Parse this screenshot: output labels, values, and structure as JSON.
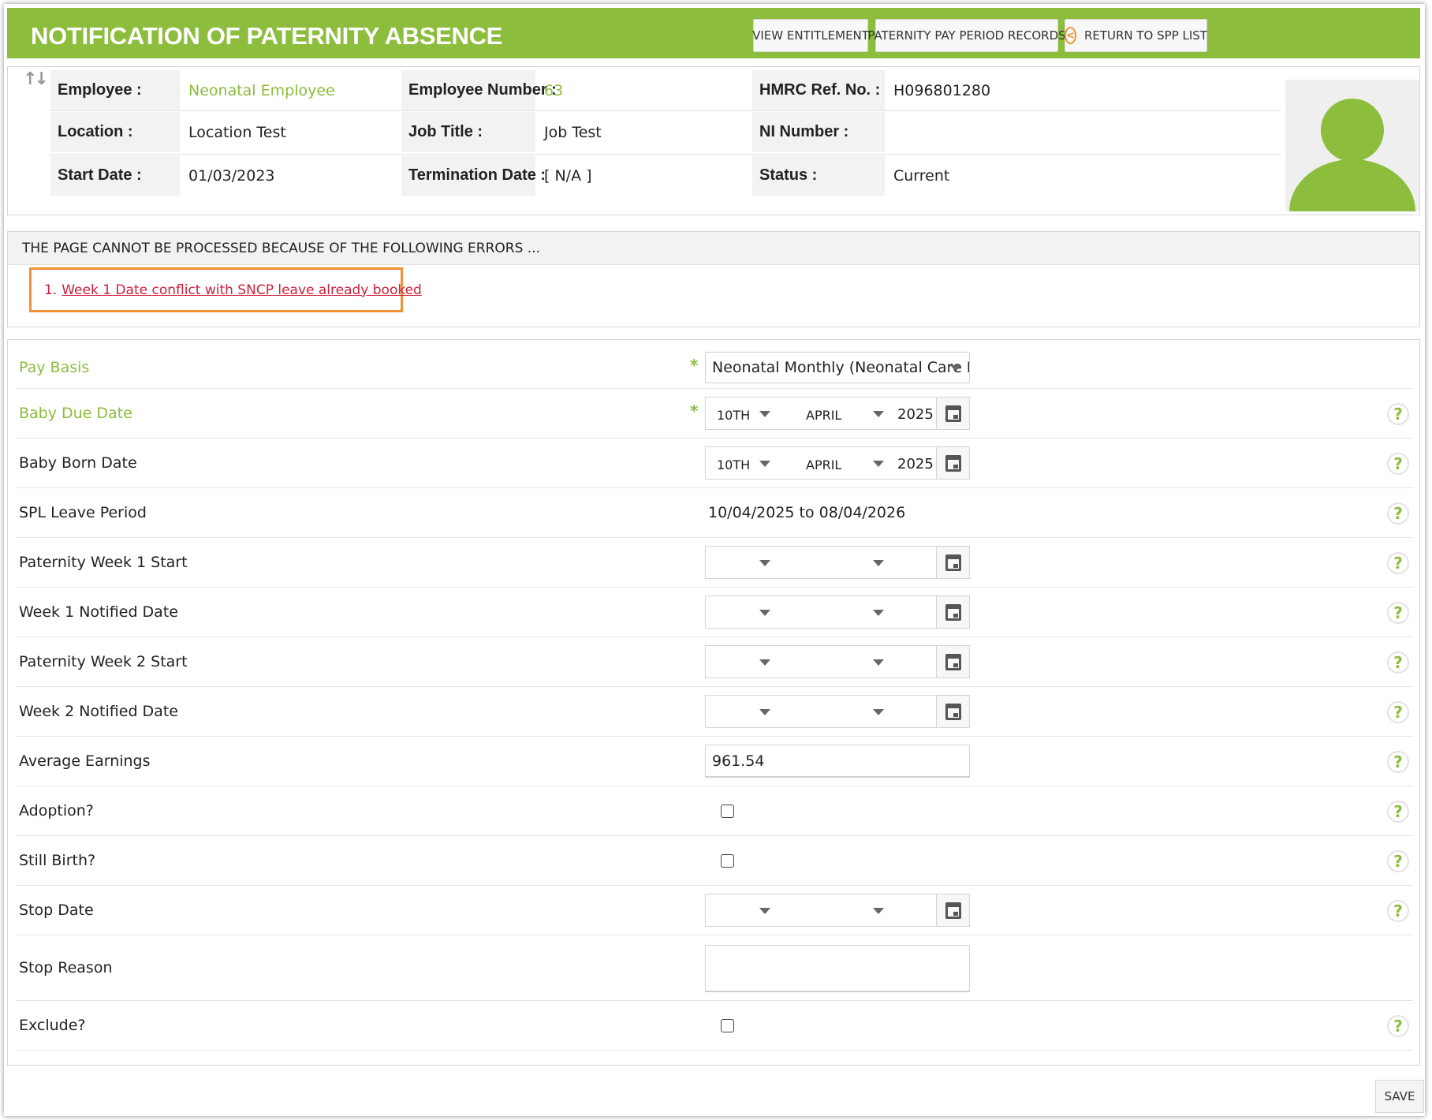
{
  "header": {
    "title": "NOTIFICATION OF PATERNITY ABSENCE",
    "buttons": {
      "view_entitlement": "VIEW ENTITLEMENT",
      "pay_period_records": "PATERNITY PAY PERIOD RECORDS",
      "return_to_list": "RETURN TO SPP LIST"
    }
  },
  "employee": {
    "employee_label": "Employee :",
    "employee_value": "Neonatal Employee",
    "employee_number_label": "Employee Number :",
    "employee_number_value": "63",
    "hmrc_label": "HMRC Ref. No. :",
    "hmrc_value": "H096801280",
    "location_label": "Location :",
    "location_value": "Location Test",
    "job_title_label": "Job Title :",
    "job_title_value": "Job Test",
    "ni_label": "NI Number :",
    "ni_value": "",
    "start_date_label": "Start Date :",
    "start_date_value": "01/03/2023",
    "termination_label": "Termination Date :",
    "termination_value": "[ N/A ]",
    "status_label": "Status :",
    "status_value": "Current"
  },
  "errors": {
    "heading": "THE PAGE CANNOT BE PROCESSED BECAUSE OF THE FOLLOWING ERRORS ...",
    "items": [
      {
        "number": "1.",
        "text": "Week 1 Date conflict with SNCP leave already booked"
      }
    ]
  },
  "form": {
    "pay_basis": {
      "label": "Pay Basis",
      "value": "Neonatal Monthly (Neonatal Care L"
    },
    "baby_due_date": {
      "label": "Baby Due Date",
      "day": "10TH",
      "month": "APRIL",
      "year": "2025"
    },
    "baby_born_date": {
      "label": "Baby Born Date",
      "day": "10TH",
      "month": "APRIL",
      "year": "2025"
    },
    "spl_leave_period": {
      "label": "SPL Leave Period",
      "value": "10/04/2025 to 08/04/2026"
    },
    "paternity_week1_start": {
      "label": "Paternity Week 1 Start"
    },
    "week1_notified_date": {
      "label": "Week 1 Notified Date"
    },
    "paternity_week2_start": {
      "label": "Paternity Week 2 Start"
    },
    "week2_notified_date": {
      "label": "Week 2 Notified Date"
    },
    "average_earnings": {
      "label": "Average Earnings",
      "value": "961.54"
    },
    "adoption": {
      "label": "Adoption?",
      "checked": false
    },
    "still_birth": {
      "label": "Still Birth?",
      "checked": false
    },
    "stop_date": {
      "label": "Stop Date"
    },
    "stop_reason": {
      "label": "Stop Reason",
      "value": ""
    },
    "exclude": {
      "label": "Exclude?",
      "checked": false
    },
    "required_marker": "*",
    "help_glyph": "?"
  },
  "footer": {
    "save_label": "SAVE"
  },
  "colors": {
    "brand_green": "#8cbd3d",
    "error_red": "#cc1f3a",
    "highlight_orange": "#f19131"
  },
  "icons": [
    "sort-arrows-icon",
    "return-circle-icon",
    "avatar-icon",
    "calendar-icon",
    "help-icon",
    "chevron-down-icon"
  ]
}
